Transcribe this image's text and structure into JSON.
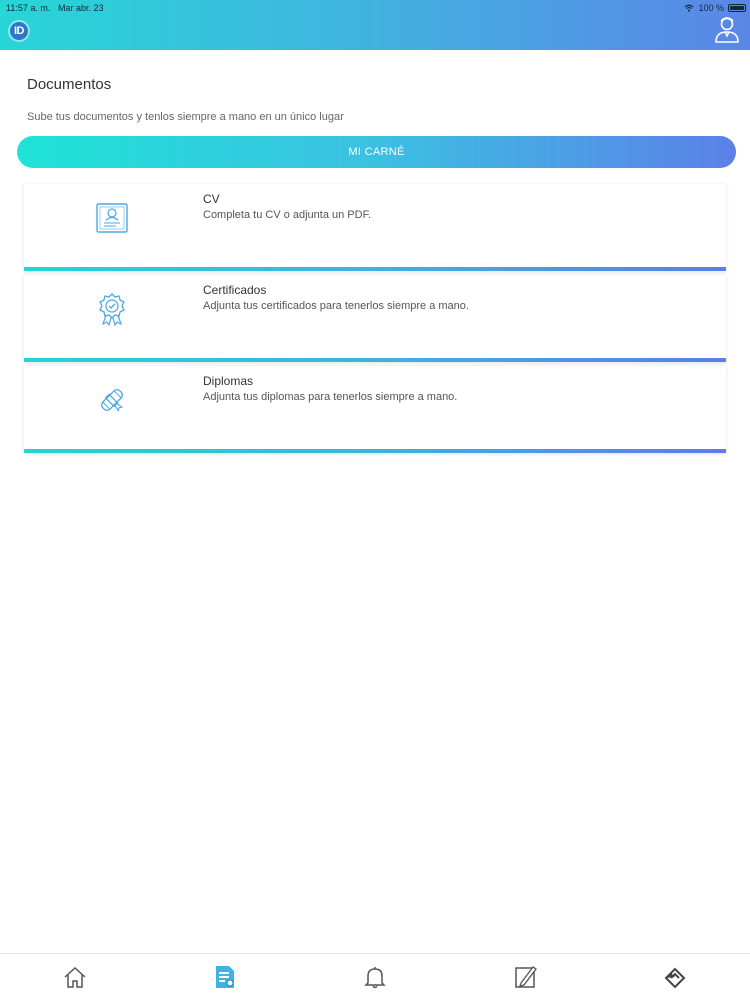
{
  "status_bar": {
    "time": "11:57 a. m.",
    "date": "Mar abr. 23",
    "battery": "100 %"
  },
  "header": {
    "logo_text": "ID",
    "profile_icon": "user-profile-icon"
  },
  "page": {
    "title": "Documentos",
    "subtitle": "Sube tus documentos y tenlos siempre a mano en un único lugar",
    "carnet_button": "MI CARNÉ"
  },
  "cards": [
    {
      "icon": "cv-document-icon",
      "title": "CV",
      "description": "Completa tu CV o adjunta un PDF."
    },
    {
      "icon": "certificate-badge-icon",
      "title": "Certificados",
      "description": "Adjunta tus certificados para tenerlos siempre a mano."
    },
    {
      "icon": "diploma-scroll-icon",
      "title": "Diplomas",
      "description": "Adjunta tus diplomas para tenerlos siempre a mano."
    }
  ],
  "tabbar": {
    "items": [
      "home-icon",
      "documents-icon",
      "bell-icon",
      "edit-note-icon",
      "app-logo-icon"
    ],
    "active": "documents-icon"
  },
  "colors": {
    "gradient_start": "#1ee3d6",
    "gradient_end": "#5b80e8",
    "icon_blue": "#4aa8e0"
  }
}
